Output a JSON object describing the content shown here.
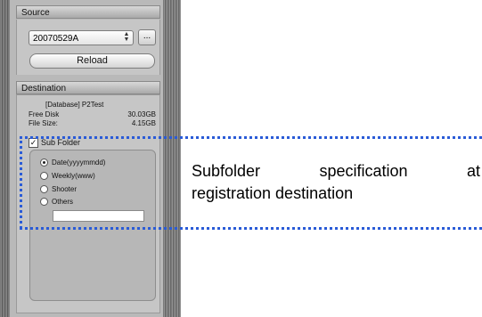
{
  "source": {
    "header": "Source",
    "selected_value": "20070529A",
    "browse_label": "...",
    "reload_label": "Reload"
  },
  "destination": {
    "header": "Destination",
    "database_line": "[Database]  P2Test",
    "free_disk_label": "Free Disk",
    "free_disk_value": "30.03GB",
    "file_size_label": "File Size:",
    "file_size_value": "4.15GB"
  },
  "subfolder": {
    "checkbox_label": "Sub Folder",
    "checked": true,
    "options": [
      {
        "label": "Date(yyyymmdd)",
        "selected": true
      },
      {
        "label": "Weekly(www)",
        "selected": false
      },
      {
        "label": "Shooter",
        "selected": false
      },
      {
        "label": "Others",
        "selected": false
      }
    ],
    "others_value": ""
  },
  "callout": {
    "line1": "Subfolder specification at",
    "line2": "registration destination",
    "highlight_color": "#2a5bd7"
  },
  "icons": [
    "select-arrows-icon",
    "checkbox-checked-icon",
    "radio-icon"
  ]
}
